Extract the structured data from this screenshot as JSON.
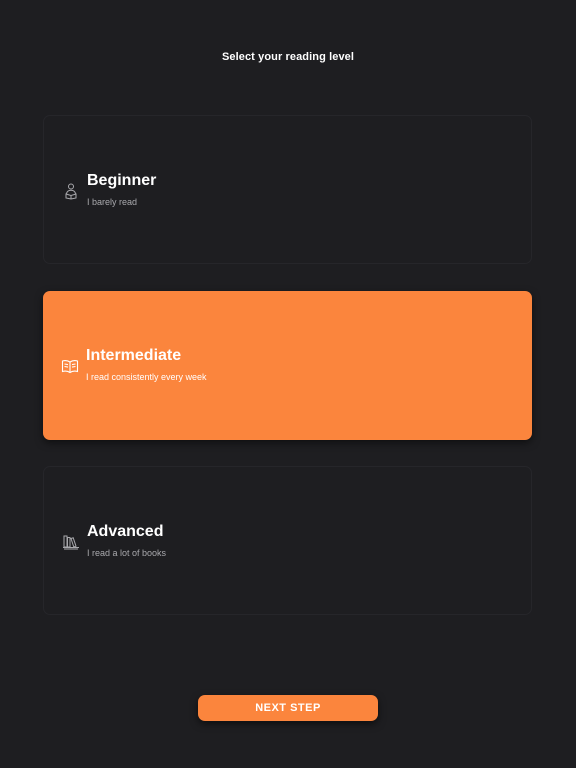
{
  "header": {
    "title": "Select your reading level"
  },
  "levels": [
    {
      "label": "Beginner",
      "description": "I barely read",
      "icon": "person-reading-icon",
      "selected": false
    },
    {
      "label": "Intermediate",
      "description": "I read consistently every week",
      "icon": "open-book-icon",
      "selected": true
    },
    {
      "label": "Advanced",
      "description": "I read a lot of books",
      "icon": "bookshelf-icon",
      "selected": false
    }
  ],
  "footer": {
    "next_label": "NEXT STEP"
  },
  "colors": {
    "background": "#1e1e21",
    "accent": "#fb853d",
    "muted_text": "#a9a9ad"
  }
}
